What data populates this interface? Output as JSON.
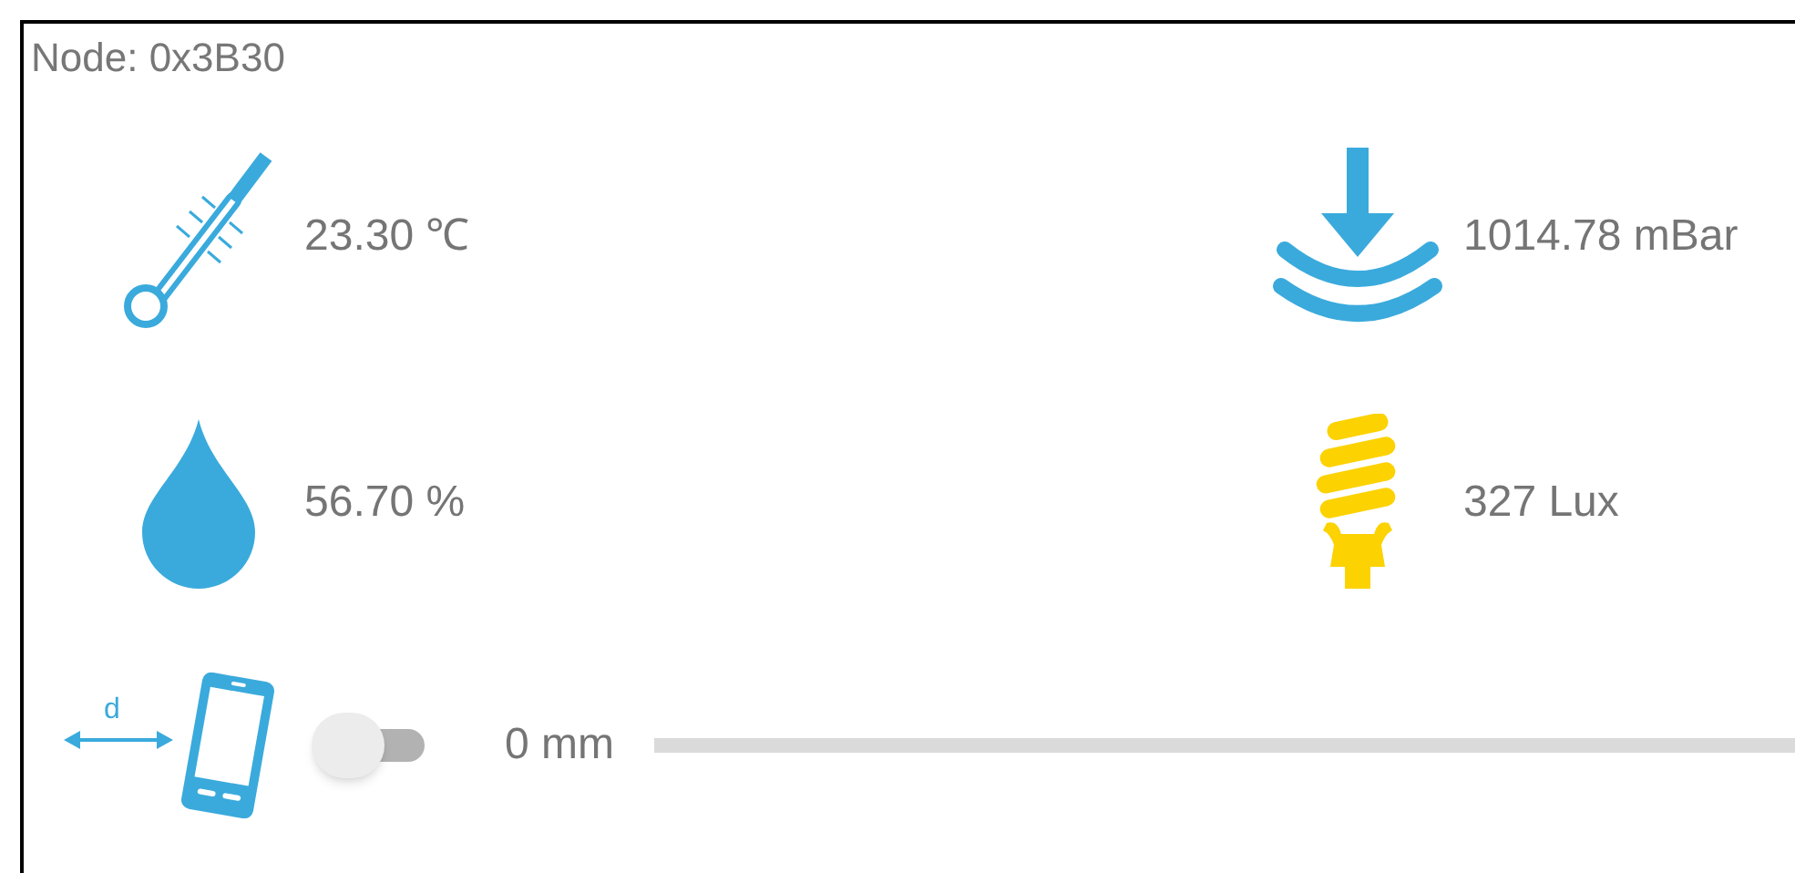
{
  "node": "Node: 0x3B30",
  "sensors": [
    {
      "kind": "temperature",
      "value": "23.30 ℃"
    },
    {
      "kind": "pressure",
      "value": "1014.78 mBar"
    },
    {
      "kind": "humidity",
      "value": "56.70 %"
    },
    {
      "kind": "light",
      "value": "327 Lux"
    }
  ],
  "proximity": {
    "icon_label": "d",
    "on": false,
    "value": "0 mm",
    "level": 0
  }
}
